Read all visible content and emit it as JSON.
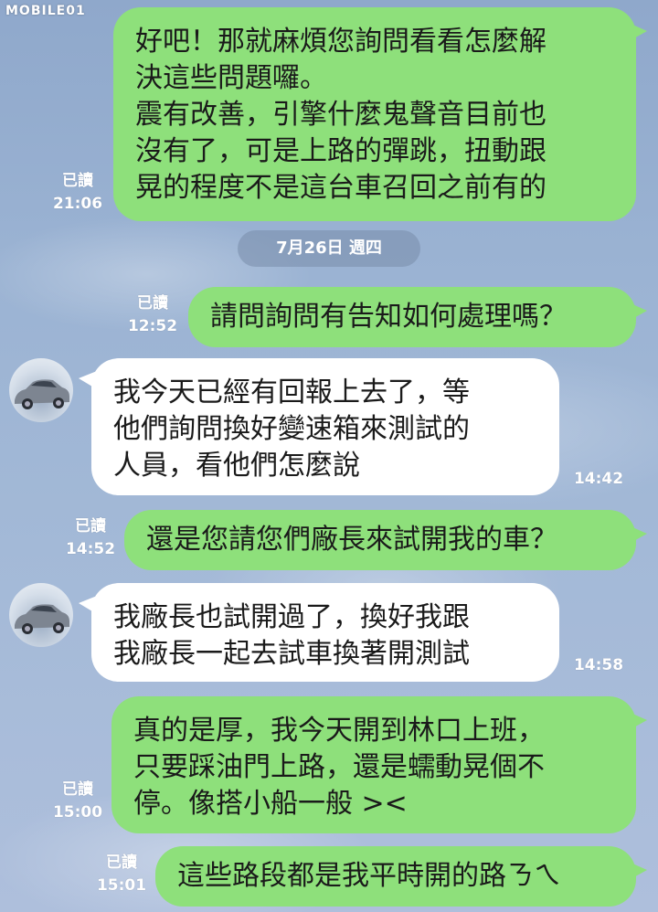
{
  "watermark": "MOBILE01",
  "date_separator": "7月26日 週四",
  "messages": [
    {
      "dir": "out",
      "text": "好吧！那就麻煩您詢問看看怎麼解\n決這些問題囉。\n震有改善，引擎什麼鬼聲音目前也\n沒有了，可是上路的彈跳，扭動跟\n晃的程度不是這台車召回之前有的",
      "read": "已讀",
      "time": "21:06"
    },
    {
      "dir": "out",
      "text": "請問詢問有告知如何處理嗎？",
      "read": "已讀",
      "time": "12:52"
    },
    {
      "dir": "in",
      "text": "我今天已經有回報上去了，等\n他們詢問換好變速箱來測試的\n人員，看他們怎麼說",
      "time": "14:42"
    },
    {
      "dir": "out",
      "text": "還是您請您們廠長來試開我的車？",
      "read": "已讀",
      "time": "14:52"
    },
    {
      "dir": "in",
      "text": "我廠長也試開過了，換好我跟\n我廠長一起去試車換著開測試",
      "time": "14:58"
    },
    {
      "dir": "out",
      "text": "真的是厚，我今天開到林口上班，\n只要踩油門上路，還是蠕動晃個不\n停。像搭小船一般 ><",
      "read": "已讀",
      "time": "15:00"
    },
    {
      "dir": "out",
      "text": "這些路段都是我平時開的路ㄋㄟ",
      "read": "已讀",
      "time": "15:01"
    }
  ],
  "colors": {
    "outgoing_bubble": "#8ee07b",
    "incoming_bubble": "#ffffff",
    "meta_text": "#ffffff"
  },
  "icons": {
    "avatar": "car-avatar-icon"
  }
}
